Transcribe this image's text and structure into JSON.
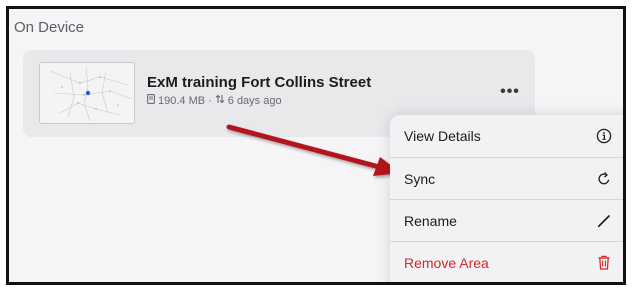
{
  "section": {
    "title": "On Device"
  },
  "area": {
    "name": "ExM training Fort Collins Street",
    "size": "190.4 MB",
    "separator": "·",
    "sync_status": "6 days ago",
    "more_label": "•••"
  },
  "menu": {
    "items": [
      {
        "label": "View Details",
        "icon": "info-icon"
      },
      {
        "label": "Sync",
        "icon": "sync-icon"
      },
      {
        "label": "Rename",
        "icon": "pencil-icon"
      },
      {
        "label": "Remove Area",
        "icon": "trash-icon"
      }
    ]
  },
  "colors": {
    "danger": "#d12a2a",
    "arrow": "#b2161c",
    "card": "#e9e9ec",
    "menu": "#f2f2f4"
  }
}
